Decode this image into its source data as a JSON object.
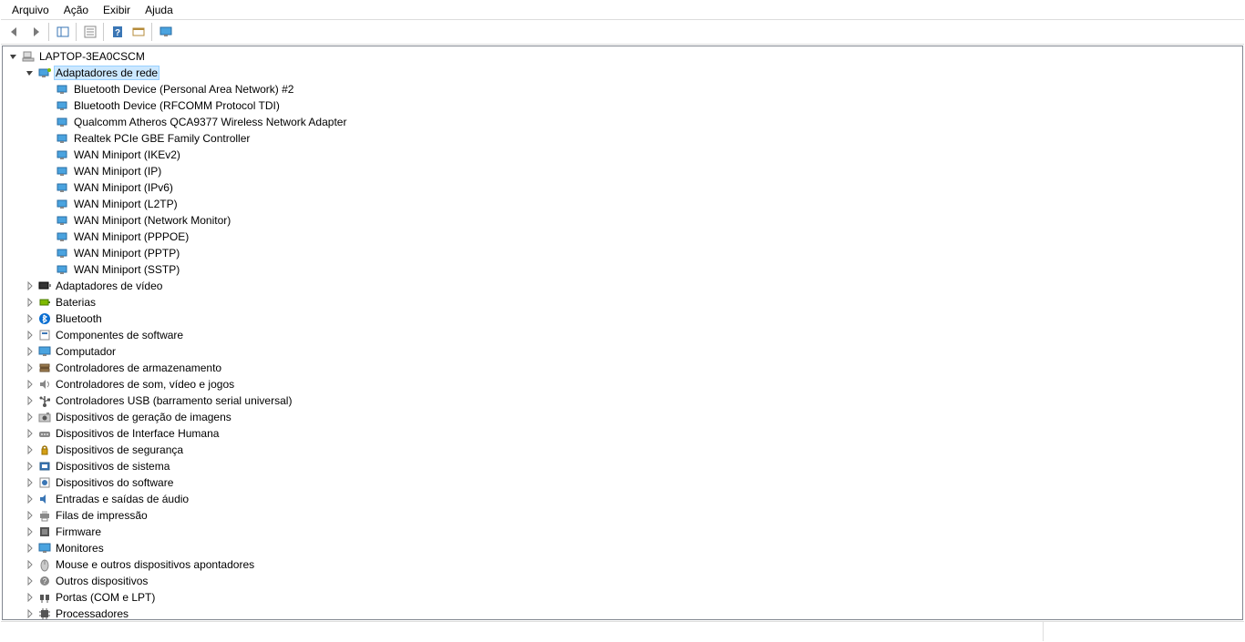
{
  "menu": {
    "arquivo": "Arquivo",
    "acao": "Ação",
    "exibir": "Exibir",
    "ajuda": "Ajuda"
  },
  "tree": {
    "root": "LAPTOP-3EA0CSCM",
    "categories": [
      {
        "name": "Adaptadores de rede",
        "expanded": true,
        "selected": true,
        "icon": "network",
        "children": [
          "Bluetooth Device (Personal Area Network) #2",
          "Bluetooth Device (RFCOMM Protocol TDI)",
          "Qualcomm Atheros QCA9377 Wireless Network Adapter",
          "Realtek PCIe GBE Family Controller",
          "WAN Miniport (IKEv2)",
          "WAN Miniport (IP)",
          "WAN Miniport (IPv6)",
          "WAN Miniport (L2TP)",
          "WAN Miniport (Network Monitor)",
          "WAN Miniport (PPPOE)",
          "WAN Miniport (PPTP)",
          "WAN Miniport (SSTP)"
        ]
      },
      {
        "name": "Adaptadores de vídeo",
        "icon": "video"
      },
      {
        "name": "Baterias",
        "icon": "battery"
      },
      {
        "name": "Bluetooth",
        "icon": "bluetooth"
      },
      {
        "name": "Componentes de software",
        "icon": "software"
      },
      {
        "name": "Computador",
        "icon": "computer"
      },
      {
        "name": "Controladores de armazenamento",
        "icon": "storage"
      },
      {
        "name": "Controladores de som, vídeo e jogos",
        "icon": "sound"
      },
      {
        "name": "Controladores USB (barramento serial universal)",
        "icon": "usb"
      },
      {
        "name": "Dispositivos de geração de imagens",
        "icon": "imaging"
      },
      {
        "name": "Dispositivos de Interface Humana",
        "icon": "hid"
      },
      {
        "name": "Dispositivos de segurança",
        "icon": "security"
      },
      {
        "name": "Dispositivos de sistema",
        "icon": "system"
      },
      {
        "name": "Dispositivos do software",
        "icon": "softdev"
      },
      {
        "name": "Entradas e saídas de áudio",
        "icon": "audio"
      },
      {
        "name": "Filas de impressão",
        "icon": "printer"
      },
      {
        "name": "Firmware",
        "icon": "firmware"
      },
      {
        "name": "Monitores",
        "icon": "monitor"
      },
      {
        "name": "Mouse e outros dispositivos apontadores",
        "icon": "mouse"
      },
      {
        "name": "Outros dispositivos",
        "icon": "other"
      },
      {
        "name": "Portas (COM e LPT)",
        "icon": "ports"
      },
      {
        "name": "Processadores",
        "icon": "cpu"
      }
    ]
  }
}
